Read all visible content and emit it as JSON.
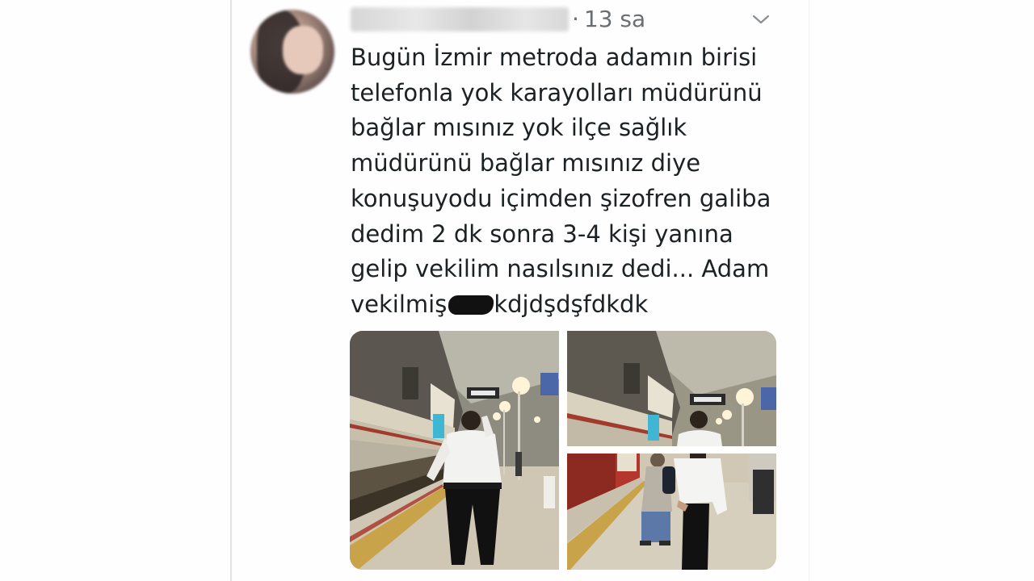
{
  "tweet": {
    "time_ago": "13 sa",
    "text_lines": [
      "Bugün İzmir metroda adamın birisi",
      "telefonla yok karayolları müdürünü",
      "bağlar mısınız yok ilçe sağlık",
      "müdürünü bağlar mısınız diye",
      "konuşuyodu içimden şizofren galiba",
      "dedim 2 dk sonra 3-4 kişi yanına",
      "gelip vekilim nasılsınız dedi... Adam"
    ],
    "last_line_before": "vekilmiş",
    "last_line_after": "kdjdşdşfdkdk"
  },
  "icons": {
    "avatar": "profile-photo-blurred",
    "menu": "chevron-down-icon"
  },
  "colors": {
    "text": "#1c2124",
    "muted": "#6a6f74",
    "divider": "#e3e3e3"
  }
}
